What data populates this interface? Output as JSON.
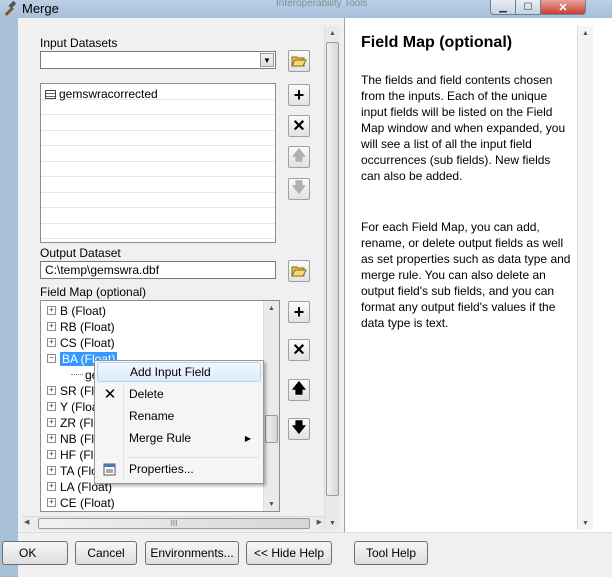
{
  "window": {
    "title": "Merge",
    "background_title": "Interoperability Tools"
  },
  "left_pane": {
    "input_datasets_label": "Input Datasets",
    "input_datasets_combo_value": "",
    "input_datasets_list": [
      "gemswracorrected"
    ],
    "output_dataset_label": "Output Dataset",
    "output_dataset_value": "C:\\temp\\gemswra.dbf",
    "field_map_label": "Field Map (optional)",
    "field_map_items": [
      {
        "label": "B (Float)",
        "expanded": false
      },
      {
        "label": "RB (Float)",
        "expanded": false
      },
      {
        "label": "CS (Float)",
        "expanded": false
      },
      {
        "label": "BA (Float)",
        "expanded": true,
        "selected": true
      },
      {
        "label": "ge",
        "child": true
      },
      {
        "label": "SR (Flo",
        "expanded": false
      },
      {
        "label": "Y (Floa",
        "expanded": false
      },
      {
        "label": "ZR (Flo",
        "expanded": false
      },
      {
        "label": "NB (Flo",
        "expanded": false
      },
      {
        "label": "HF (Flo",
        "expanded": false
      },
      {
        "label": "TA (Flo",
        "expanded": false
      },
      {
        "label": "LA (Float)",
        "expanded": false
      },
      {
        "label": "CE (Float)",
        "expanded": false
      }
    ],
    "hscroll_grip": "III"
  },
  "context_menu": {
    "items": [
      {
        "label": "Add Input Field",
        "icon": "",
        "highlighted": true
      },
      {
        "label": "Delete",
        "icon": "delete-x-icon"
      },
      {
        "label": "Rename",
        "icon": ""
      },
      {
        "label": "Merge Rule",
        "icon": "",
        "submenu": true
      },
      {
        "label": "Properties...",
        "icon": "properties-icon"
      }
    ]
  },
  "help": {
    "title": "Field Map (optional)",
    "paragraph1": "The fields and field contents chosen from the inputs. Each of the unique input fields will be listed on the Field Map window and when expanded, you will see a list of all the input field occurrences (sub fields). New fields can also be added.",
    "paragraph2": "For each Field Map, you can add, rename, or delete output fields as well as set properties such as data type and merge rule. You can also delete an output field's sub fields, and you can format any output field's values if the data type is text."
  },
  "buttons": {
    "ok": "OK",
    "cancel": "Cancel",
    "environments": "Environments...",
    "hide_help": "<< Hide Help",
    "tool_help": "Tool Help"
  },
  "colors": {
    "selection": "#3399ff",
    "menu_highlight": "#dcebfc",
    "close_button": "#c6402f"
  }
}
